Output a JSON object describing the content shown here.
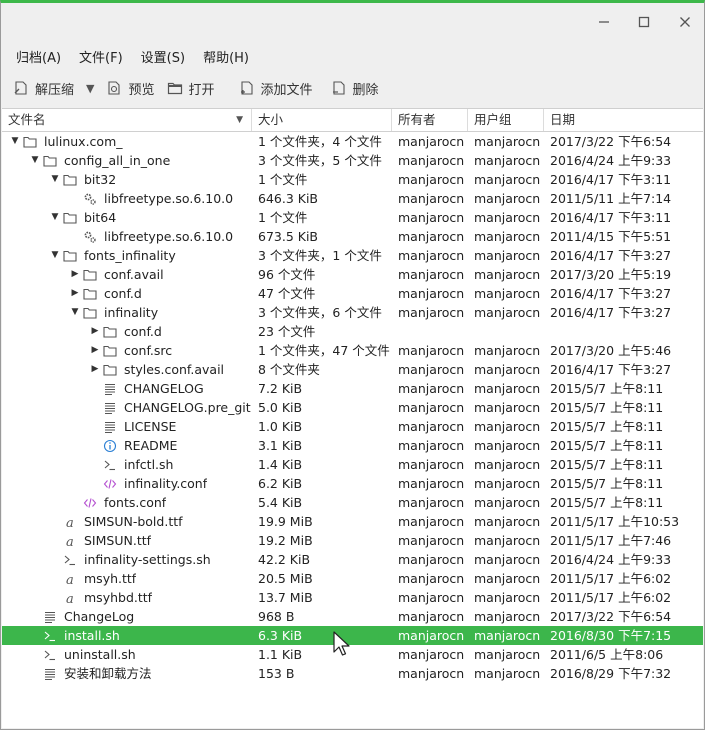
{
  "window": {
    "buttons": [
      "minimize",
      "maximize",
      "close"
    ]
  },
  "menu": [
    {
      "label": "归档(A)"
    },
    {
      "label": "文件(F)"
    },
    {
      "label": "设置(S)"
    },
    {
      "label": "帮助(H)"
    }
  ],
  "toolbar": {
    "extract": "解压缩",
    "preview": "预览",
    "open": "打开",
    "add": "添加文件",
    "delete": "删除"
  },
  "columns": {
    "name": "文件名",
    "size": "大小",
    "owner": "所有者",
    "group": "用户组",
    "date": "日期"
  },
  "rows": [
    {
      "level": 0,
      "exp": "down",
      "icon": "folder",
      "name": "lulinux.com_",
      "size": "1 个文件夹，4 个文件",
      "owner": "manjarocn",
      "group": "manjarocn",
      "date": "2017/3/22 下午6:54"
    },
    {
      "level": 1,
      "exp": "down",
      "icon": "folder",
      "name": "config_all_in_one",
      "size": "3 个文件夹，5 个文件",
      "owner": "manjarocn",
      "group": "manjarocn",
      "date": "2016/4/24 上午9:33"
    },
    {
      "level": 2,
      "exp": "down",
      "icon": "folder",
      "name": "bit32",
      "size": "1 个文件",
      "owner": "manjarocn",
      "group": "manjarocn",
      "date": "2016/4/17 下午3:11"
    },
    {
      "level": 3,
      "exp": "",
      "icon": "gear",
      "name": "libfreetype.so.6.10.0",
      "size": "646.3 KiB",
      "owner": "manjarocn",
      "group": "manjarocn",
      "date": "2011/5/11 上午7:14"
    },
    {
      "level": 2,
      "exp": "down",
      "icon": "folder",
      "name": "bit64",
      "size": "1 个文件",
      "owner": "manjarocn",
      "group": "manjarocn",
      "date": "2016/4/17 下午3:11"
    },
    {
      "level": 3,
      "exp": "",
      "icon": "gear",
      "name": "libfreetype.so.6.10.0",
      "size": "673.5 KiB",
      "owner": "manjarocn",
      "group": "manjarocn",
      "date": "2011/4/15 下午5:51"
    },
    {
      "level": 2,
      "exp": "down",
      "icon": "folder",
      "name": "fonts_infinality",
      "size": "3 个文件夹，1 个文件",
      "owner": "manjarocn",
      "group": "manjarocn",
      "date": "2016/4/17 下午3:27"
    },
    {
      "level": 3,
      "exp": "right",
      "icon": "folder",
      "name": "conf.avail",
      "size": "96 个文件",
      "owner": "manjarocn",
      "group": "manjarocn",
      "date": "2017/3/20 上午5:19"
    },
    {
      "level": 3,
      "exp": "right",
      "icon": "folder",
      "name": "conf.d",
      "size": "47 个文件",
      "owner": "manjarocn",
      "group": "manjarocn",
      "date": "2016/4/17 下午3:27"
    },
    {
      "level": 3,
      "exp": "down",
      "icon": "folder",
      "name": "infinality",
      "size": "3 个文件夹，6 个文件",
      "owner": "manjarocn",
      "group": "manjarocn",
      "date": "2016/4/17 下午3:27"
    },
    {
      "level": 4,
      "exp": "right",
      "icon": "folder",
      "name": "conf.d",
      "size": "23 个文件",
      "owner": "",
      "group": "",
      "date": ""
    },
    {
      "level": 4,
      "exp": "right",
      "icon": "folder",
      "name": "conf.src",
      "size": "1 个文件夹，47 个文件",
      "owner": "manjarocn",
      "group": "manjarocn",
      "date": "2017/3/20 上午5:46"
    },
    {
      "level": 4,
      "exp": "right",
      "icon": "folder",
      "name": "styles.conf.avail",
      "size": "8 个文件夹",
      "owner": "manjarocn",
      "group": "manjarocn",
      "date": "2016/4/17 下午3:27"
    },
    {
      "level": 4,
      "exp": "",
      "icon": "text",
      "name": "CHANGELOG",
      "size": "7.2 KiB",
      "owner": "manjarocn",
      "group": "manjarocn",
      "date": "2015/5/7 上午8:11"
    },
    {
      "level": 4,
      "exp": "",
      "icon": "text",
      "name": "CHANGELOG.pre_git",
      "size": "5.0 KiB",
      "owner": "manjarocn",
      "group": "manjarocn",
      "date": "2015/5/7 上午8:11"
    },
    {
      "level": 4,
      "exp": "",
      "icon": "text",
      "name": "LICENSE",
      "size": "1.0 KiB",
      "owner": "manjarocn",
      "group": "manjarocn",
      "date": "2015/5/7 上午8:11"
    },
    {
      "level": 4,
      "exp": "",
      "icon": "info",
      "name": "README",
      "size": "3.1 KiB",
      "owner": "manjarocn",
      "group": "manjarocn",
      "date": "2015/5/7 上午8:11"
    },
    {
      "level": 4,
      "exp": "",
      "icon": "shell",
      "name": "infctl.sh",
      "size": "1.4 KiB",
      "owner": "manjarocn",
      "group": "manjarocn",
      "date": "2015/5/7 上午8:11"
    },
    {
      "level": 4,
      "exp": "",
      "icon": "code",
      "name": "infinality.conf",
      "size": "6.2 KiB",
      "owner": "manjarocn",
      "group": "manjarocn",
      "date": "2015/5/7 上午8:11"
    },
    {
      "level": 3,
      "exp": "",
      "icon": "code",
      "name": "fonts.conf",
      "size": "5.4 KiB",
      "owner": "manjarocn",
      "group": "manjarocn",
      "date": "2015/5/7 上午8:11"
    },
    {
      "level": 2,
      "exp": "",
      "icon": "font",
      "name": "SIMSUN-bold.ttf",
      "size": "19.9 MiB",
      "owner": "manjarocn",
      "group": "manjarocn",
      "date": "2011/5/17 上午10:53"
    },
    {
      "level": 2,
      "exp": "",
      "icon": "font",
      "name": "SIMSUN.ttf",
      "size": "19.2 MiB",
      "owner": "manjarocn",
      "group": "manjarocn",
      "date": "2011/5/17 上午7:46"
    },
    {
      "level": 2,
      "exp": "",
      "icon": "shell",
      "name": "infinality-settings.sh",
      "size": "42.2 KiB",
      "owner": "manjarocn",
      "group": "manjarocn",
      "date": "2016/4/24 上午9:33"
    },
    {
      "level": 2,
      "exp": "",
      "icon": "font",
      "name": "msyh.ttf",
      "size": "20.5 MiB",
      "owner": "manjarocn",
      "group": "manjarocn",
      "date": "2011/5/17 上午6:02"
    },
    {
      "level": 2,
      "exp": "",
      "icon": "font",
      "name": "msyhbd.ttf",
      "size": "13.7 MiB",
      "owner": "manjarocn",
      "group": "manjarocn",
      "date": "2011/5/17 上午6:02"
    },
    {
      "level": 1,
      "exp": "",
      "icon": "text",
      "name": "ChangeLog",
      "size": "968 B",
      "owner": "manjarocn",
      "group": "manjarocn",
      "date": "2017/3/22 下午6:54"
    },
    {
      "level": 1,
      "exp": "",
      "icon": "shell",
      "name": "install.sh",
      "size": "6.3 KiB",
      "owner": "manjarocn",
      "group": "manjarocn",
      "date": "2016/8/30 下午7:15",
      "selected": true
    },
    {
      "level": 1,
      "exp": "",
      "icon": "shell",
      "name": "uninstall.sh",
      "size": "1.1 KiB",
      "owner": "manjarocn",
      "group": "manjarocn",
      "date": "2011/6/5 上午8:06"
    },
    {
      "level": 1,
      "exp": "",
      "icon": "text",
      "name": "安装和卸载方法",
      "size": "153 B",
      "owner": "manjarocn",
      "group": "manjarocn",
      "date": "2016/8/29 下午7:32"
    }
  ],
  "colors": {
    "accent": "#3cb64b",
    "icon": "#555555",
    "code_icon": "#b44fd0",
    "info_icon": "#2a7fd4"
  }
}
